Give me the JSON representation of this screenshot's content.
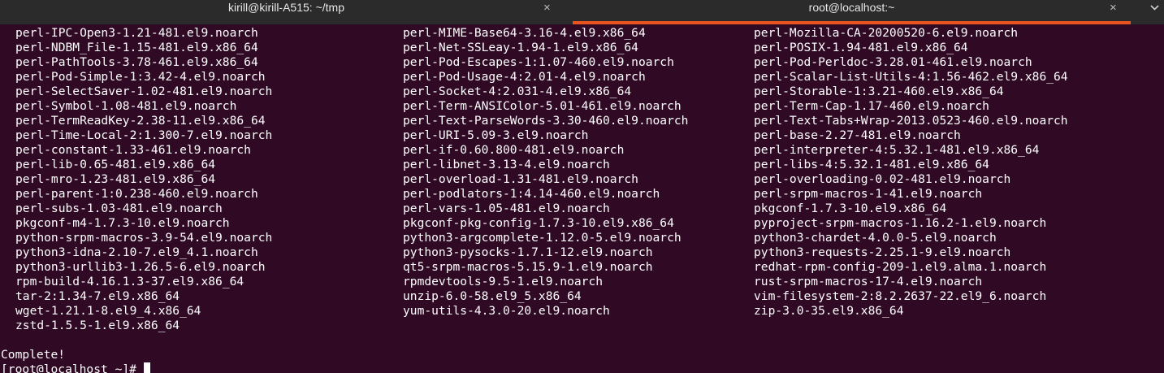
{
  "tabs": [
    {
      "title": "kirill@kirill-A515: ~/tmp",
      "close": "×",
      "active": false
    },
    {
      "title": "root@localhost:~",
      "close": "×",
      "active": true
    }
  ],
  "colors": {
    "terminal_bg": "#300a24",
    "tabbar_bg": "#2b2b2b",
    "active_tab_indicator": "#e95420",
    "text": "#ffffff"
  },
  "terminal": {
    "columns": [
      [
        "perl-IPC-Open3-1.21-481.el9.noarch",
        "perl-NDBM_File-1.15-481.el9.x86_64",
        "perl-PathTools-3.78-461.el9.x86_64",
        "perl-Pod-Simple-1:3.42-4.el9.noarch",
        "perl-SelectSaver-1.02-481.el9.noarch",
        "perl-Symbol-1.08-481.el9.noarch",
        "perl-TermReadKey-2.38-11.el9.x86_64",
        "perl-Time-Local-2:1.300-7.el9.noarch",
        "perl-constant-1.33-461.el9.noarch",
        "perl-lib-0.65-481.el9.x86_64",
        "perl-mro-1.23-481.el9.x86_64",
        "perl-parent-1:0.238-460.el9.noarch",
        "perl-subs-1.03-481.el9.noarch",
        "pkgconf-m4-1.7.3-10.el9.noarch",
        "python-srpm-macros-3.9-54.el9.noarch",
        "python3-idna-2.10-7.el9_4.1.noarch",
        "python3-urllib3-1.26.5-6.el9.noarch",
        "rpm-build-4.16.1.3-37.el9.x86_64",
        "tar-2:1.34-7.el9.x86_64",
        "wget-1.21.1-8.el9_4.x86_64",
        "zstd-1.5.5-1.el9.x86_64"
      ],
      [
        "perl-MIME-Base64-3.16-4.el9.x86_64",
        "perl-Net-SSLeay-1.94-1.el9.x86_64",
        "perl-Pod-Escapes-1:1.07-460.el9.noarch",
        "perl-Pod-Usage-4:2.01-4.el9.noarch",
        "perl-Socket-4:2.031-4.el9.x86_64",
        "perl-Term-ANSIColor-5.01-461.el9.noarch",
        "perl-Text-ParseWords-3.30-460.el9.noarch",
        "perl-URI-5.09-3.el9.noarch",
        "perl-if-0.60.800-481.el9.noarch",
        "perl-libnet-3.13-4.el9.noarch",
        "perl-overload-1.31-481.el9.noarch",
        "perl-podlators-1:4.14-460.el9.noarch",
        "perl-vars-1.05-481.el9.noarch",
        "pkgconf-pkg-config-1.7.3-10.el9.x86_64",
        "python3-argcomplete-1.12.0-5.el9.noarch",
        "python3-pysocks-1.7.1-12.el9.noarch",
        "qt5-srpm-macros-5.15.9-1.el9.noarch",
        "rpmdevtools-9.5-1.el9.noarch",
        "unzip-6.0-58.el9_5.x86_64",
        "yum-utils-4.3.0-20.el9.noarch"
      ],
      [
        "perl-Mozilla-CA-20200520-6.el9.noarch",
        "perl-POSIX-1.94-481.el9.x86_64",
        "perl-Pod-Perldoc-3.28.01-461.el9.noarch",
        "perl-Scalar-List-Utils-4:1.56-462.el9.x86_64",
        "perl-Storable-1:3.21-460.el9.x86_64",
        "perl-Term-Cap-1.17-460.el9.noarch",
        "perl-Text-Tabs+Wrap-2013.0523-460.el9.noarch",
        "perl-base-2.27-481.el9.noarch",
        "perl-interpreter-4:5.32.1-481.el9.x86_64",
        "perl-libs-4:5.32.1-481.el9.x86_64",
        "perl-overloading-0.02-481.el9.noarch",
        "perl-srpm-macros-1-41.el9.noarch",
        "pkgconf-1.7.3-10.el9.x86_64",
        "pyproject-srpm-macros-1.16.2-1.el9.noarch",
        "python3-chardet-4.0.0-5.el9.noarch",
        "python3-requests-2.25.1-9.el9.noarch",
        "redhat-rpm-config-209-1.el9.alma.1.noarch",
        "rust-srpm-macros-17-4.el9.noarch",
        "vim-filesystem-2:8.2.2637-22.el9_6.noarch",
        "zip-3.0-35.el9.x86_64"
      ]
    ],
    "complete_message": "Complete!",
    "prompt": "[root@localhost ~]#"
  }
}
